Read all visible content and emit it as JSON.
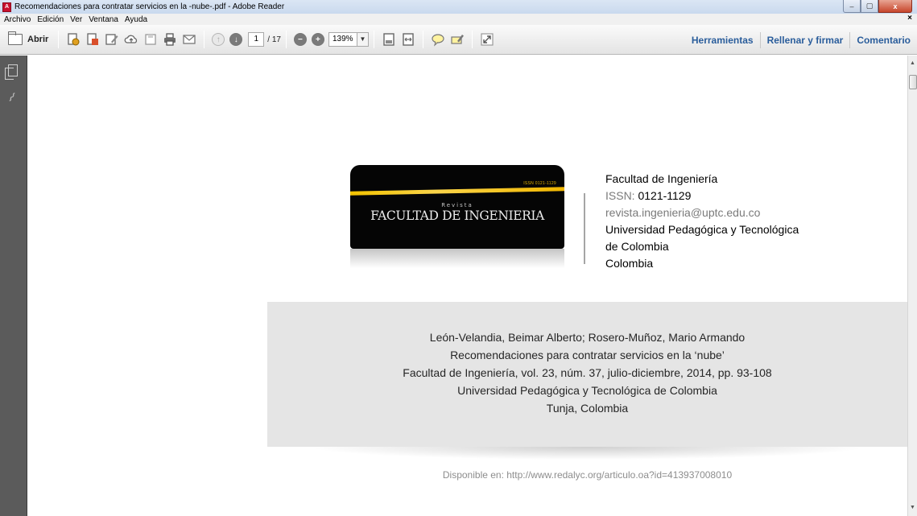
{
  "window": {
    "title": "Recomendaciones para contratar servicios en la -nube-.pdf - Adobe Reader",
    "controls": {
      "minimize": "–",
      "maximize": "▢",
      "close": "x"
    }
  },
  "menu": {
    "items": [
      "Archivo",
      "Edición",
      "Ver",
      "Ventana",
      "Ayuda"
    ],
    "close_glyph": "×"
  },
  "toolbar": {
    "open_label": "Abrir",
    "page_current": "1",
    "page_total": "/ 17",
    "zoom": "139%",
    "zoom_dropdown_glyph": "▼",
    "zoom_out_glyph": "−",
    "zoom_in_glyph": "+",
    "prev_glyph": "↑",
    "next_glyph": "↓",
    "right_links": [
      "Herramientas",
      "Rellenar y firmar",
      "Comentario"
    ]
  },
  "document": {
    "logo": {
      "revista": "Revista",
      "name": "FACULTAD DE INGENIERIA",
      "issn_small": "ISSN 0121-1129"
    },
    "journal": {
      "name": "Facultad de Ingeniería",
      "issn_label": "ISSN: ",
      "issn_value": "0121-1129",
      "email": "revista.ingenieria@uptc.edu.co",
      "university_line1": "Universidad Pedagógica y Tecnológica",
      "university_line2": "de Colombia",
      "country": "Colombia"
    },
    "citation": {
      "authors": "León-Velandia, Beimar Alberto; Rosero-Muñoz, Mario Armando",
      "title": "Recomendaciones para contratar servicios en la ‘nube’",
      "source": "Facultad de Ingeniería, vol. 23, núm. 37, julio-diciembre, 2014, pp. 93-108",
      "institution": "Universidad Pedagógica y Tecnológica de Colombia",
      "place": "Tunja, Colombia"
    },
    "available": "Disponible en: http://www.redalyc.org/articulo.oa?id=413937008010"
  }
}
